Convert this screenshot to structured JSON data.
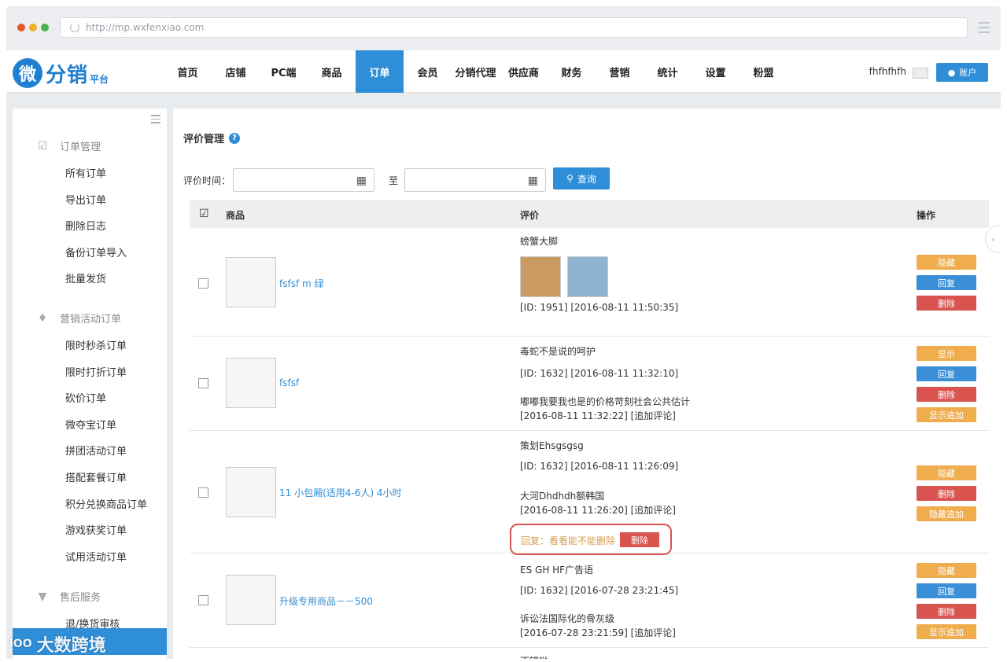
{
  "browser": {
    "url": "http://mp.wxfenxiao.com"
  },
  "logo": {
    "mark": "微",
    "text": "分销",
    "sub": "平台"
  },
  "nav": {
    "items": [
      "首页",
      "店铺",
      "PC端",
      "商品",
      "订单",
      "会员",
      "分销代理",
      "供应商",
      "财务",
      "营销",
      "统计",
      "设置",
      "粉盟"
    ],
    "active_index": 4,
    "username": "fhfhfhfh",
    "account_label": "账户"
  },
  "sidebar": {
    "groups": [
      {
        "label": "订单管理",
        "icon": "clipboard-icon",
        "items": [
          "所有订单",
          "导出订单",
          "删除日志",
          "备份订单导入",
          "批量发货"
        ]
      },
      {
        "label": "营销活动订单",
        "icon": "tag-icon",
        "items": [
          "限时秒杀订单",
          "限时打折订单",
          "砍价订单",
          "微夺宝订单",
          "拼团活动订单",
          "搭配套餐订单",
          "积分兑换商品订单",
          "游戏获奖订单",
          "试用活动订单"
        ]
      },
      {
        "label": "售后服务",
        "icon": "shield-icon",
        "items": [
          "退/换货审核"
        ]
      }
    ]
  },
  "page": {
    "title": "评价管理",
    "filter_label": "评价时间：",
    "to_label": "至",
    "search_label": "查询"
  },
  "table": {
    "headers": {
      "goods": "商品",
      "review": "评价",
      "ops": "操作"
    },
    "rows": [
      {
        "goods": "fsfsf m 绿",
        "review_lines": [
          "螃蟹大脚",
          "[ID: 1951] [2016-08-11 11:50:35]"
        ],
        "buttons": [
          {
            "label": "隐藏",
            "color": "orange"
          },
          {
            "label": "回复",
            "color": "blue"
          },
          {
            "label": "删除",
            "color": "red"
          }
        ]
      },
      {
        "goods": "fsfsf",
        "review_lines": [
          "毒蛇不是说的呵护",
          "[ID: 1632] [2016-08-11 11:32:10]",
          "嘟嘟我要我也是的价格苛刻社会公共估计",
          "[2016-08-11 11:32:22] [追加评论]"
        ],
        "buttons": [
          {
            "label": "显示",
            "color": "orange"
          },
          {
            "label": "回复",
            "color": "blue"
          },
          {
            "label": "删除",
            "color": "red"
          },
          {
            "label": "显示追加",
            "color": "orange"
          }
        ]
      },
      {
        "goods": "11 小包厢(适用4-6人) 4小时",
        "review_lines": [
          "策划Ehsgsgsg",
          "[ID: 1632] [2016-08-11 11:26:09]",
          "大河Dhdhdh额韩国",
          "[2016-08-11 11:26:20] [追加评论]"
        ],
        "reply": {
          "text": "回复：看看能不能删除",
          "delete_label": "删除"
        },
        "buttons": [
          {
            "label": "隐藏",
            "color": "orange"
          },
          {
            "label": "删除",
            "color": "red"
          },
          {
            "label": "隐藏追加",
            "color": "orange"
          }
        ]
      },
      {
        "goods": "升级专用商品－－500",
        "review_lines": [
          "ES GH HF广告语",
          "[ID: 1632] [2016-07-28 23:21:45]",
          "诉讼法国际化的骨灰级",
          "[2016-07-28 23:21:59] [追加评论]"
        ],
        "buttons": [
          {
            "label": "隐藏",
            "color": "orange"
          },
          {
            "label": "回复",
            "color": "blue"
          },
          {
            "label": "删除",
            "color": "red"
          },
          {
            "label": "显示追加",
            "color": "orange"
          }
        ]
      },
      {
        "goods": "",
        "review_lines": [
          "不错呦"
        ],
        "buttons": []
      }
    ]
  },
  "watermark": {
    "text": "大数跨境",
    "mark": "lOO"
  },
  "colors": {
    "primary": "#2e8ed8",
    "orange": "#f0ad4e",
    "blue": "#3a8fd8",
    "red": "#d9534f"
  }
}
